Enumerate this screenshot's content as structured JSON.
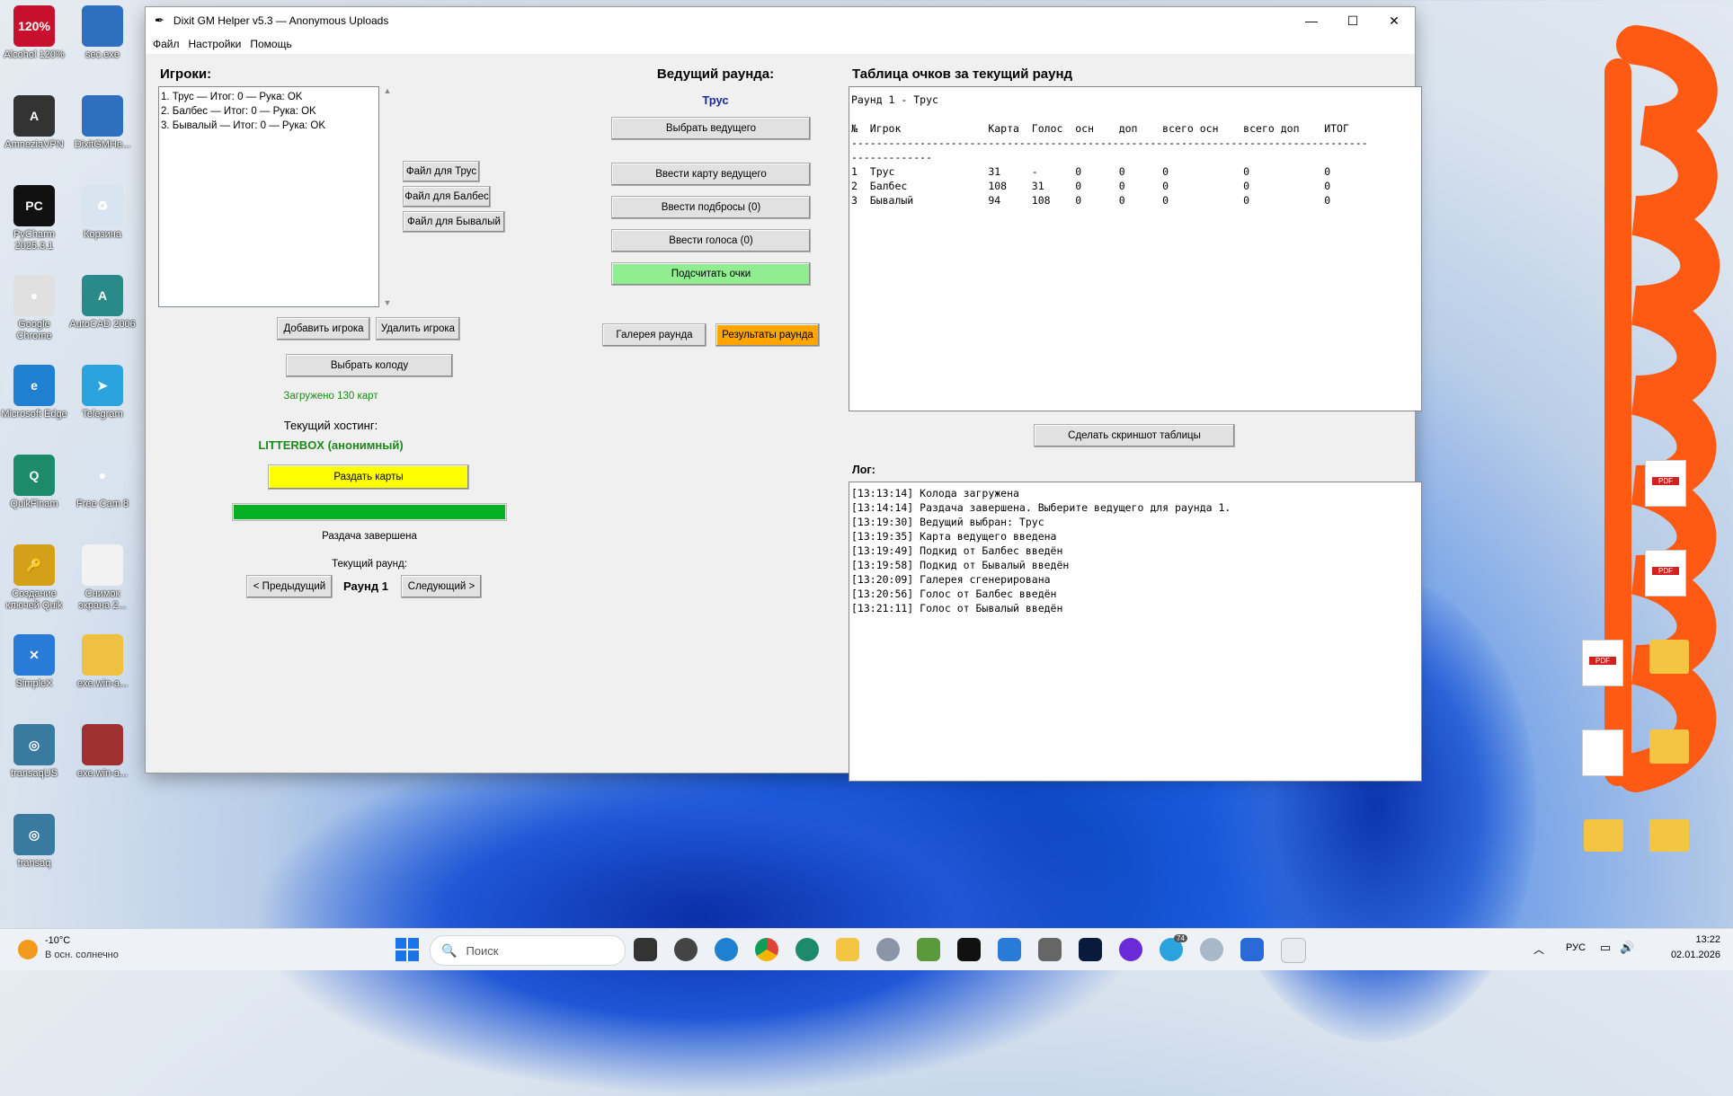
{
  "window": {
    "title": "Dixit GM Helper v5.3 — Anonymous Uploads",
    "menu": [
      "Файл",
      "Настройки",
      "Помощь"
    ]
  },
  "players": {
    "header": "Игроки:",
    "items": [
      "1. Трус — Итог: 0 — Рука: OK",
      "2. Балбес — Итог: 0 — Рука: OK",
      "3. Бывалый — Итог: 0 — Рука: OK"
    ],
    "file_buttons": [
      "Файл для Трус",
      "Файл для Балбес",
      "Файл для Бывалый"
    ],
    "add_label": "Добавить игрока",
    "remove_label": "Удалить игрока",
    "deck_label": "Выбрать колоду",
    "loaded_status": "Загружено 130 карт",
    "hosting_label": "Текущий хостинг:",
    "hosting_value": "LITTERBOX (анонимный)",
    "deal_label": "Раздать карты",
    "deal_progress": 1.0,
    "deal_status": "Раздача завершена",
    "round_label": "Текущий раунд:",
    "prev_label": "< Предыдущий",
    "round_value": "Раунд 1",
    "next_label": "Следующий >"
  },
  "leader": {
    "header": "Ведущий раунда:",
    "name": "Трус",
    "choose_label": "Выбрать ведущего",
    "enter_card_label": "Ввести карту ведущего",
    "enter_tosses_label": "Ввести подбросы (0)",
    "enter_votes_label": "Ввести голоса (0)",
    "count_label": "Подсчитать очки",
    "gallery_label": "Галерея раунда",
    "results_label": "Результаты раунда"
  },
  "scores": {
    "header": "Таблица очков за текущий раунд",
    "lines": [
      "Раунд 1 - Трус",
      "",
      "№  Игрок              Карта  Голос  осн    доп    всего осн    всего доп    ИТОГ",
      "-----------------------------------------------------------------------------------",
      "-------------",
      "1  Трус               31     -      0      0      0            0            0",
      "2  Балбес             108    31     0      0      0            0            0",
      "3  Бывалый            94     108    0      0      0            0            0"
    ],
    "screenshot_label": "Сделать скриншот таблицы"
  },
  "log": {
    "header": "Лог:",
    "lines": [
      "[13:13:14] Колода загружена",
      "[13:14:14] Раздача завершена. Выберите ведущего для раунда 1.",
      "[13:19:30] Ведущий выбран: Трус",
      "[13:19:35] Карта ведущего введена",
      "[13:19:49] Подкид от Балбес введён",
      "[13:19:58] Подкид от Бывалый введён",
      "[13:20:09] Галерея сгенерирована",
      "[13:20:56] Голос от Балбес введён",
      "[13:21:11] Голос от Бывалый введён"
    ]
  },
  "desktop_icons": [
    {
      "label": "Alcohol 120%",
      "color": "#c8102e",
      "glyph": "120%"
    },
    {
      "label": "sec.exe",
      "color": "#2f6fbf",
      "glyph": ""
    },
    {
      "label": "AmneziaVPN",
      "color": "#333333",
      "glyph": "A"
    },
    {
      "label": "DixitGMHe...",
      "color": "#2f6fbf",
      "glyph": ""
    },
    {
      "label": "PyCharm 2025.3.1",
      "color": "#111111",
      "glyph": "PC"
    },
    {
      "label": "Корзина",
      "color": "#d8e4f0",
      "glyph": "♻"
    },
    {
      "label": "Google Chrome",
      "color": "#e0e0e0",
      "glyph": "●"
    },
    {
      "label": "AutoCAD 2006",
      "color": "#2a8a8a",
      "glyph": "A"
    },
    {
      "label": "Microsoft Edge",
      "color": "#1f7fd0",
      "glyph": "e"
    },
    {
      "label": "Telegram",
      "color": "#2aa3de",
      "glyph": "➤"
    },
    {
      "label": "QuikFinam",
      "color": "#1d8a6a",
      "glyph": "Q"
    },
    {
      "label": "Free Cam 8",
      "color": "#d8e4f0",
      "glyph": "●"
    },
    {
      "label": "Создание ключей Quik",
      "color": "#d4a017",
      "glyph": "🔑"
    },
    {
      "label": "Снимок экрана 2...",
      "color": "#f2f2f2",
      "glyph": ""
    },
    {
      "label": "SimpleX",
      "color": "#2a7ad8",
      "glyph": "✕"
    },
    {
      "label": "exe.win-a...",
      "color": "#f0c040",
      "glyph": ""
    },
    {
      "label": "transaqUS",
      "color": "#3a7aa0",
      "glyph": "◎"
    },
    {
      "label": "exe.win-a...",
      "color": "#a03030",
      "glyph": ""
    },
    {
      "label": "transaq",
      "color": "#3a7aa0",
      "glyph": "◎"
    }
  ],
  "taskbar": {
    "weather_temp": "-10°C",
    "weather_desc": "В осн. солнечно",
    "search_placeholder": "Поиск",
    "lang": "РУС",
    "time": "13:22",
    "date": "02.01.2026",
    "badge": "74"
  }
}
